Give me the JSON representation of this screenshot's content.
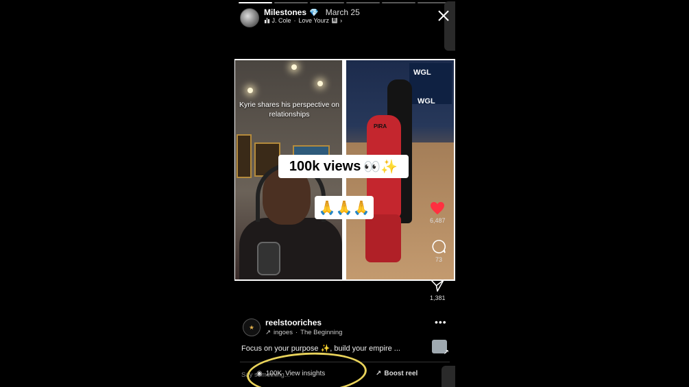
{
  "story": {
    "username": "Milestones",
    "verified_icon": "diamond-icon",
    "date": "March 25",
    "music_artist": "J. Cole",
    "music_title": "Love Yourz",
    "music_line_sep": "·",
    "progress": {
      "segments": 6,
      "active_index": 0
    }
  },
  "media": {
    "left_caption": "Kyrie shares his perspective on relationships",
    "overlay_text": "100k views",
    "overlay_emoji": "👀✨",
    "second_overlay_emoji": "🙏🙏🙏",
    "banner_text_top": "WGL",
    "banner_text_bottom": "WGL",
    "jersey_text": "PIRA"
  },
  "actions": {
    "likes": "6,487",
    "comments": "73",
    "shares": "1,381",
    "like_color": "#ff3040"
  },
  "reel": {
    "username": "reelstooriches",
    "audio_prefix": "ingoes",
    "audio_title": "The Beginning",
    "audio_sep": "·",
    "caption": "Focus on your purpose ✨, build your empire ..."
  },
  "bottom": {
    "comment_placeholder": "Say something...",
    "views": "100K",
    "insights_label": "View insights",
    "boost_label": "Boost reel",
    "annotation_color": "#e8d25a"
  }
}
